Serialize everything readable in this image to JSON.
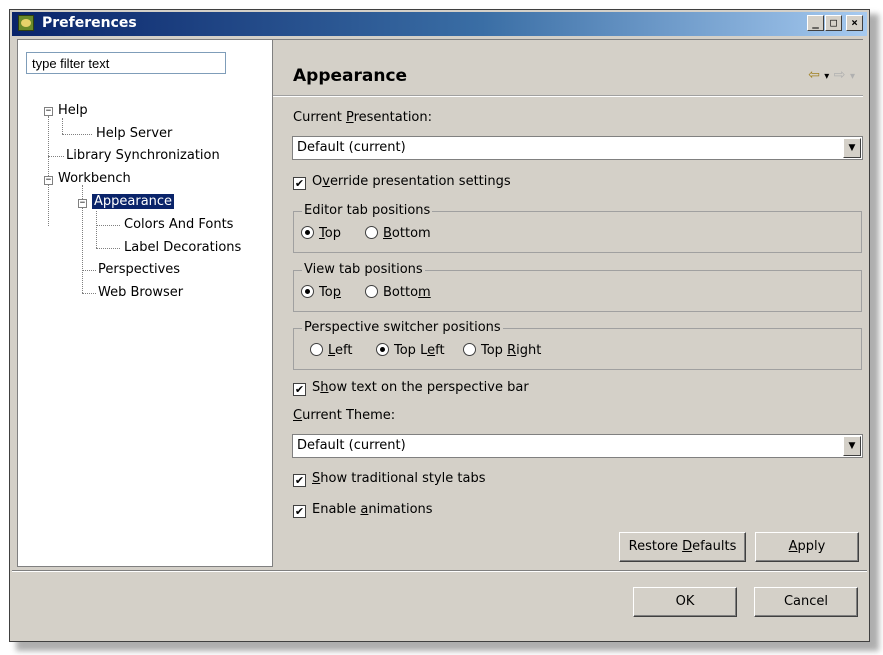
{
  "window": {
    "title": "Preferences",
    "caption_min": "_",
    "caption_max": "□",
    "caption_close": "×"
  },
  "filter": {
    "value": "type filter text"
  },
  "tree": {
    "help": "Help",
    "help_server": "Help Server",
    "library_sync": "Library Synchronization",
    "workbench": "Workbench",
    "appearance": "Appearance",
    "colors_fonts": "Colors And Fonts",
    "label_decorations": "Label Decorations",
    "perspectives": "Perspectives",
    "web_browser": "Web Browser"
  },
  "page": {
    "title": "Appearance",
    "back_icon": "⇦",
    "forward_icon": "⇨",
    "dropdown_icon": "▾"
  },
  "presentation": {
    "label_pre": "Current ",
    "label_u": "P",
    "label_post": "resentation:",
    "value": "Default (current)"
  },
  "override": {
    "pre": "O",
    "u": "v",
    "post": "erride presentation settings",
    "checked": true
  },
  "editor_tabs": {
    "title": "Editor tab positions",
    "top_u": "T",
    "top_post": "op",
    "bottom_u": "B",
    "bottom_post": "ottom",
    "selected": "Top"
  },
  "view_tabs": {
    "title": "View tab positions",
    "top_pre": "To",
    "top_u": "p",
    "bottom_pre": "Botto",
    "bottom_u": "m",
    "selected": "Top"
  },
  "perspective_switcher": {
    "title": "Perspective switcher positions",
    "left_u": "L",
    "left_post": "eft",
    "topleft_pre": "Top L",
    "topleft_u": "e",
    "topleft_post": "ft",
    "topright_pre": "Top ",
    "topright_u": "R",
    "topright_post": "ight",
    "selected": "Top Left"
  },
  "show_text": {
    "pre": "S",
    "u": "h",
    "post": "ow text on the perspective bar",
    "checked": true
  },
  "theme": {
    "label_u": "C",
    "label_post": "urrent Theme:",
    "value": "Default (current)"
  },
  "traditional_tabs": {
    "u": "S",
    "post": "how traditional style tabs",
    "checked": true
  },
  "animations": {
    "pre": "Enable ",
    "u": "a",
    "post": "nimations",
    "checked": true
  },
  "buttons": {
    "restore_pre": "Restore ",
    "restore_u": "D",
    "restore_post": "efaults",
    "apply_u": "A",
    "apply_post": "pply",
    "ok": "OK",
    "cancel": "Cancel"
  }
}
